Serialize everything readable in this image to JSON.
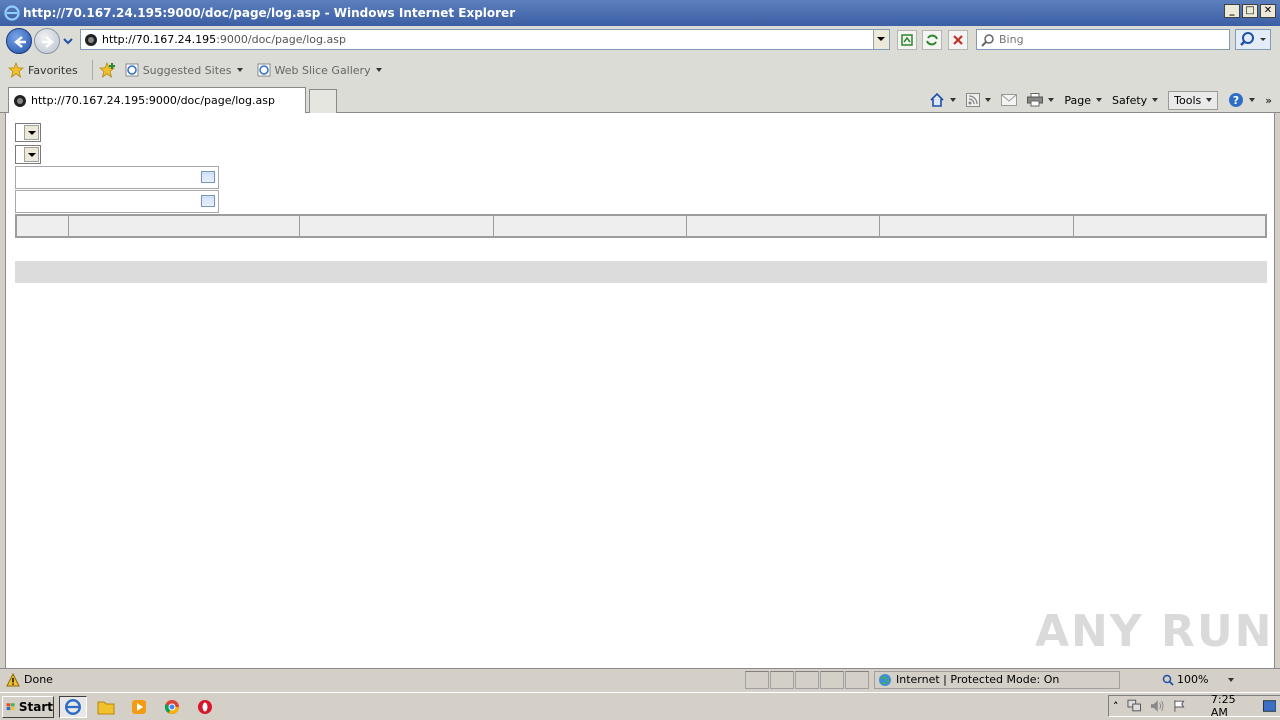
{
  "window": {
    "title": "http://70.167.24.195:9000/doc/page/log.asp - Windows Internet Explorer",
    "minimize": "_",
    "maximize": "□",
    "close": "✕"
  },
  "address_bar": {
    "url_host": "http://70.167.24.195",
    "url_path": ":9000/doc/page/log.asp",
    "search_placeholder": "Bing"
  },
  "favorites_bar": {
    "favorites_label": "Favorites",
    "suggested_sites": "Suggested Sites",
    "web_slice_gallery": "Web Slice Gallery"
  },
  "tabs": [
    {
      "label": "http://70.167.24.195:9000/doc/page/log.asp"
    }
  ],
  "command_bar": {
    "page": "Page",
    "safety": "Safety",
    "tools": "Tools",
    "overflow": "»"
  },
  "status_bar": {
    "status_text": "Done",
    "zone_text": "Internet | Protected Mode: On",
    "zoom": "100%"
  },
  "taskbar": {
    "start_label": "Start",
    "clock": "7:25 AM"
  },
  "watermark": "ANY RUN",
  "colors": {
    "titlebar": "#3c5fa5",
    "chrome": "#dcdcd6",
    "grid_header": "#eeeeee",
    "grid_bar": "#dcdcdc"
  }
}
